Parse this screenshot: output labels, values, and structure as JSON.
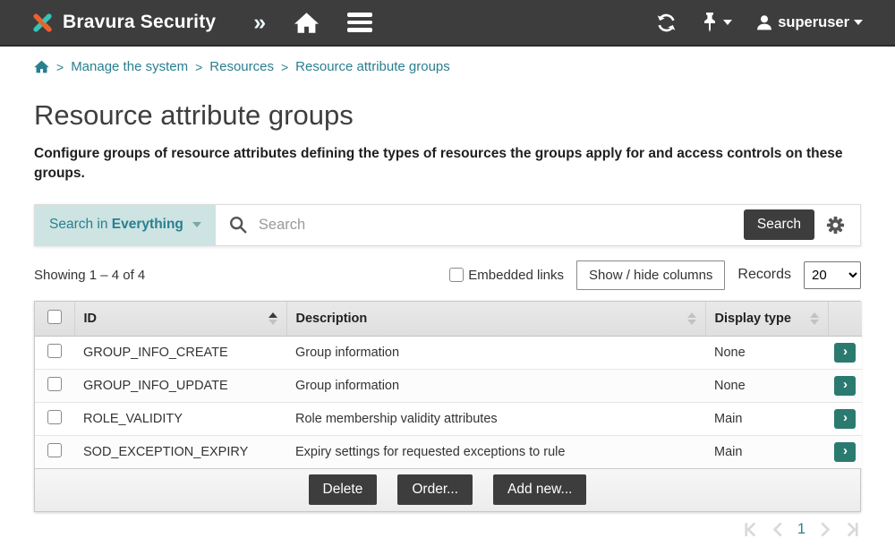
{
  "navbar": {
    "brand": "Bravura Security",
    "user": "superuser"
  },
  "breadcrumb": {
    "separator": ">",
    "items": [
      "Manage the system",
      "Resources",
      "Resource attribute groups"
    ]
  },
  "page": {
    "title": "Resource attribute groups",
    "description": "Configure groups of resource attributes defining the types of resources the groups apply for and access controls on these groups."
  },
  "search": {
    "scope_prefix": "Search in",
    "scope_value": "Everything",
    "placeholder": "Search",
    "button_label": "Search"
  },
  "controls": {
    "showing": "Showing 1 – 4 of 4",
    "embedded_links_label": "Embedded links",
    "show_hide_label": "Show / hide columns",
    "records_label": "Records",
    "records_value": "20"
  },
  "table": {
    "columns": [
      "ID",
      "Description",
      "Display type"
    ],
    "sorted_column": "ID",
    "sort_direction": "asc",
    "rows": [
      {
        "id": "GROUP_INFO_CREATE",
        "description": "Group information",
        "display_type": "None"
      },
      {
        "id": "GROUP_INFO_UPDATE",
        "description": "Group information",
        "display_type": "None"
      },
      {
        "id": "ROLE_VALIDITY",
        "description": "Role membership validity attributes",
        "display_type": "Main"
      },
      {
        "id": "SOD_EXCEPTION_EXPIRY",
        "description": "Expiry settings for requested exceptions to rule",
        "display_type": "Main"
      }
    ],
    "actions": [
      "Delete",
      "Order...",
      "Add new..."
    ]
  },
  "pagination": {
    "current_page": "1"
  },
  "icons": {
    "row_open_glyph": "›"
  },
  "colors": {
    "navbar_bg": "#3d3d3d",
    "accent_teal": "#2a7f90",
    "scope_bg": "#cde4e2",
    "button_dark": "#3d3d3d",
    "row_action_teal": "#2b7a6f",
    "logo_orange": "#e8622d",
    "logo_teal": "#35c4b5"
  }
}
